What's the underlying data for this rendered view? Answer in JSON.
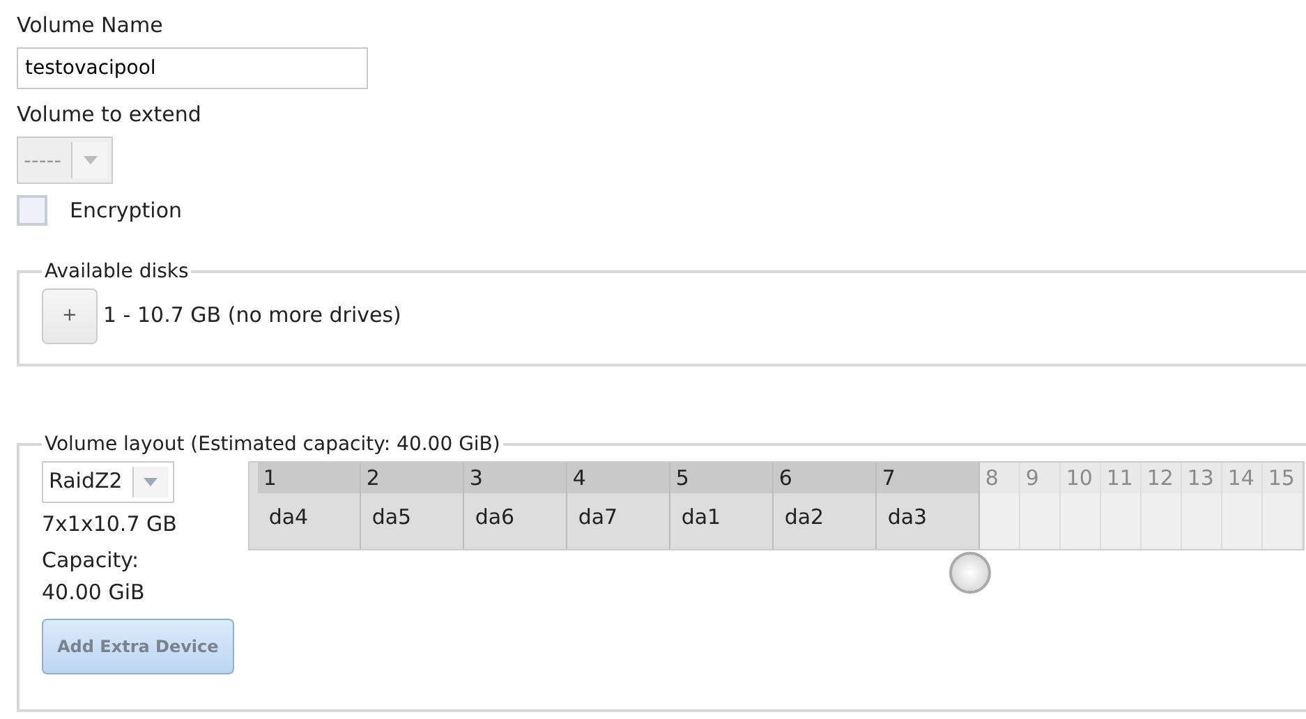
{
  "volume_name": {
    "label": "Volume Name",
    "value": "testovacipool"
  },
  "volume_to_extend": {
    "label": "Volume to extend",
    "value": "-----",
    "disabled": true
  },
  "encryption": {
    "label": "Encryption",
    "checked": false
  },
  "available_disks": {
    "legend": "Available disks",
    "add_button": "+",
    "text": "1 - 10.7 GB (no more drives)"
  },
  "volume_layout": {
    "legend": "Volume layout (Estimated capacity: 40.00 GiB)",
    "raid_type": "RaidZ2",
    "disks_summary": "7x1x10.7 GB",
    "capacity_label": "Capacity:",
    "capacity_value": "40.00 GiB",
    "add_extra_button": "Add Extra Device",
    "columns": [
      {
        "label": "1",
        "device": "da4",
        "used": true
      },
      {
        "label": "2",
        "device": "da5",
        "used": true
      },
      {
        "label": "3",
        "device": "da6",
        "used": true
      },
      {
        "label": "4",
        "device": "da7",
        "used": true
      },
      {
        "label": "5",
        "device": "da1",
        "used": true
      },
      {
        "label": "6",
        "device": "da2",
        "used": true
      },
      {
        "label": "7",
        "device": "da3",
        "used": true
      },
      {
        "label": "8",
        "used": false
      },
      {
        "label": "9",
        "used": false
      },
      {
        "label": "10",
        "used": false
      },
      {
        "label": "11",
        "used": false
      },
      {
        "label": "12",
        "used": false
      },
      {
        "label": "13",
        "used": false
      },
      {
        "label": "14",
        "used": false
      },
      {
        "label": "15",
        "used": false
      }
    ]
  }
}
